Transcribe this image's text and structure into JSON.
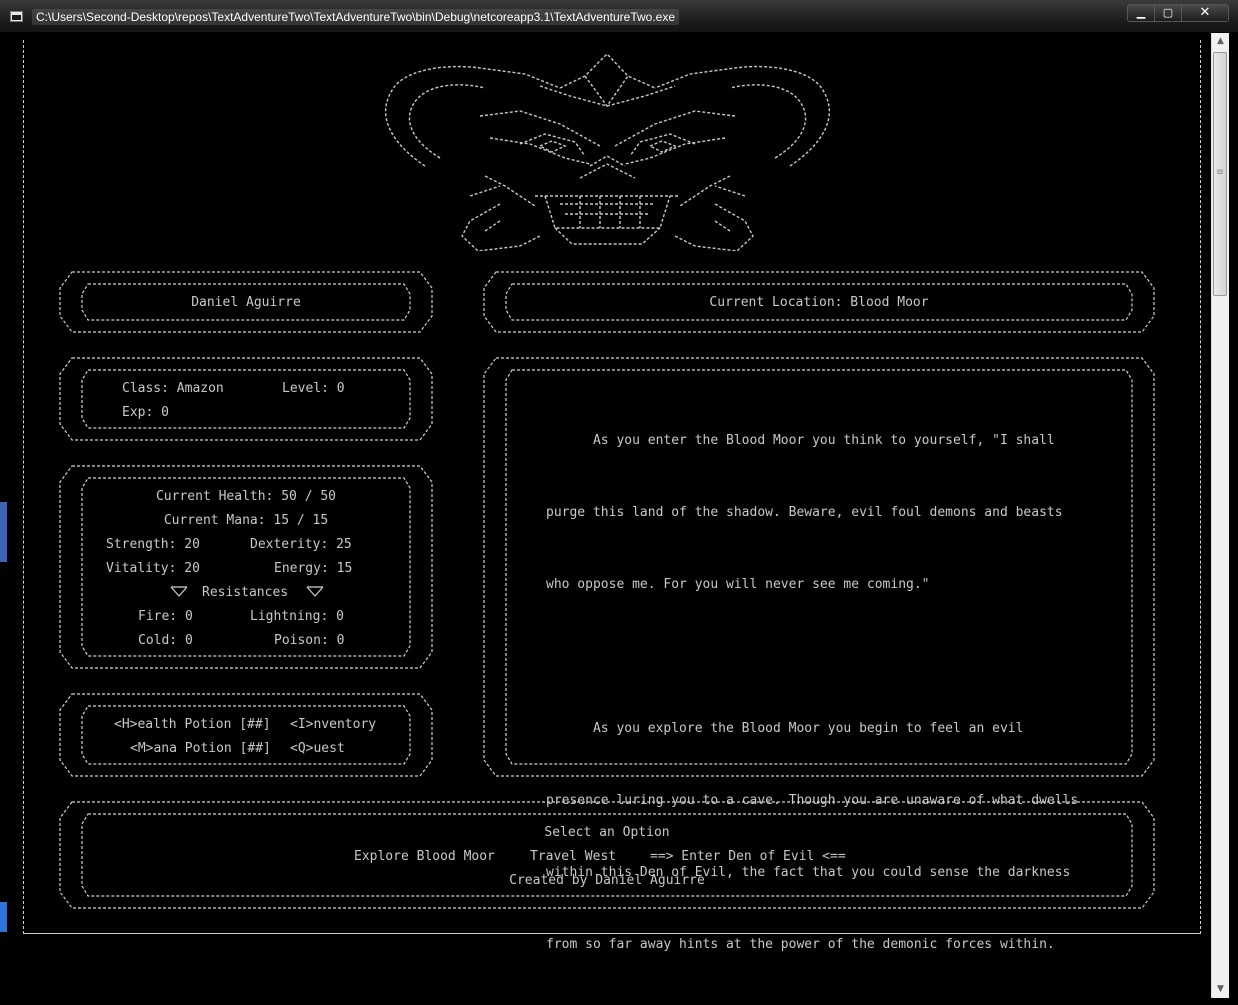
{
  "window": {
    "title": "C:\\Users\\Second-Desktop\\repos\\TextAdventureTwo\\TextAdventureTwo\\bin\\Debug\\netcoreapp3.1\\TextAdventureTwo.exe",
    "minimize_glyph": "▁",
    "maximize_glyph": "▢",
    "close_glyph": "✕"
  },
  "player": {
    "name": "Daniel Aguirre",
    "class_label": "Class: Amazon",
    "level_label": "Level: 0",
    "exp_label": "Exp: 0"
  },
  "stats": {
    "health": "Current Health: 50 / 50",
    "mana": "Current Mana: 15 / 15",
    "strength": "Strength: 20",
    "dexterity": "Dexterity: 25",
    "vitality": "Vitality: 20",
    "energy": "Energy: 15",
    "resistances_label": "Resistances",
    "fire": "Fire: 0",
    "lightning": "Lightning: 0",
    "cold": "Cold: 0",
    "poison": "Poison: 0"
  },
  "actions": {
    "health_potion": "<H>ealth Potion [##]",
    "inventory": "<I>nventory",
    "mana_potion": "<M>ana Potion [##]",
    "quest": "<Q>uest"
  },
  "location": {
    "label": "Current Location: Blood Moor"
  },
  "story": {
    "lines": [
      "      As you enter the Blood Moor you think to yourself, \"I shall",
      "purge this land of the shadow. Beware, evil foul demons and beasts",
      "who oppose me. For you will never see me coming.\"",
      "",
      "      As you explore the Blood Moor you begin to feel an evil",
      "presence luring you to a cave. Though you are unaware of what dwells",
      "within this Den of Evil, the fact that you could sense the darkness",
      "from so far away hints at the power of the demonic forces within."
    ]
  },
  "menu": {
    "prompt": "Select an Option",
    "options": [
      "Explore Blood Moor",
      "Travel West",
      "==> Enter Den of Evil <=="
    ],
    "credit": "Created by Daniel Aguirre"
  },
  "colors": {
    "background": "#000000",
    "text": "#c8c8c8",
    "frame": "#cfcfcf"
  }
}
